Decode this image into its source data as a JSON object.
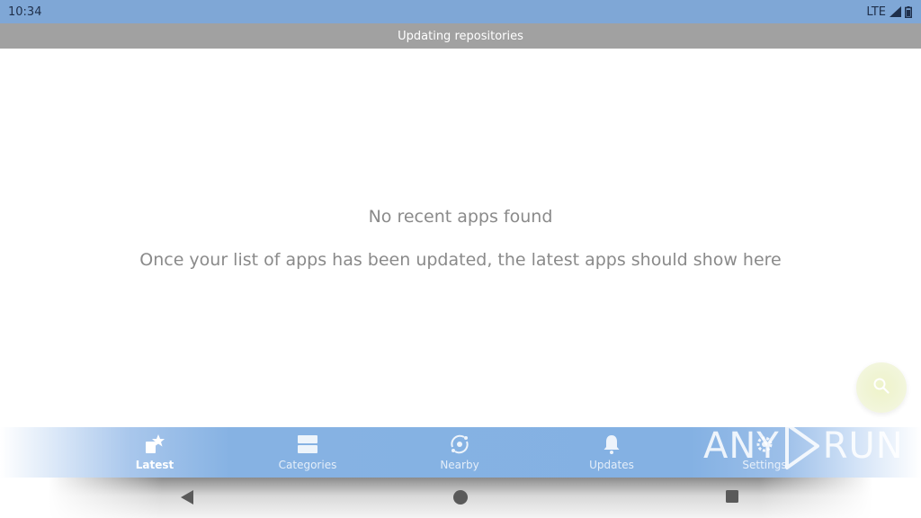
{
  "status_bar": {
    "time": "10:34",
    "network": "LTE",
    "icons": [
      "signal-icon",
      "battery-icon"
    ]
  },
  "banner": {
    "text": "Updating repositories"
  },
  "empty_state": {
    "title": "No recent apps found",
    "subtitle": "Once your list of apps has been updated, the latest apps should show here"
  },
  "fab": {
    "icon": "search-icon"
  },
  "bottom_nav": {
    "items": [
      {
        "label": "Latest",
        "icon": "latest-icon",
        "active": true
      },
      {
        "label": "Categories",
        "icon": "categories-icon",
        "active": false
      },
      {
        "label": "Nearby",
        "icon": "nearby-icon",
        "active": false
      },
      {
        "label": "Updates",
        "icon": "bell-icon",
        "active": false
      },
      {
        "label": "Settings",
        "icon": "gear-icon",
        "active": false
      }
    ]
  },
  "watermark": {
    "left": "ANY",
    "right": "RUN"
  },
  "system_nav": {
    "buttons": [
      "back-icon",
      "home-icon",
      "recents-icon"
    ]
  },
  "colors": {
    "status_bar": "#7fa7d6",
    "banner": "#a1a1a1",
    "nav_accent": "#84b1e3",
    "empty_text": "#8a8a8a"
  }
}
